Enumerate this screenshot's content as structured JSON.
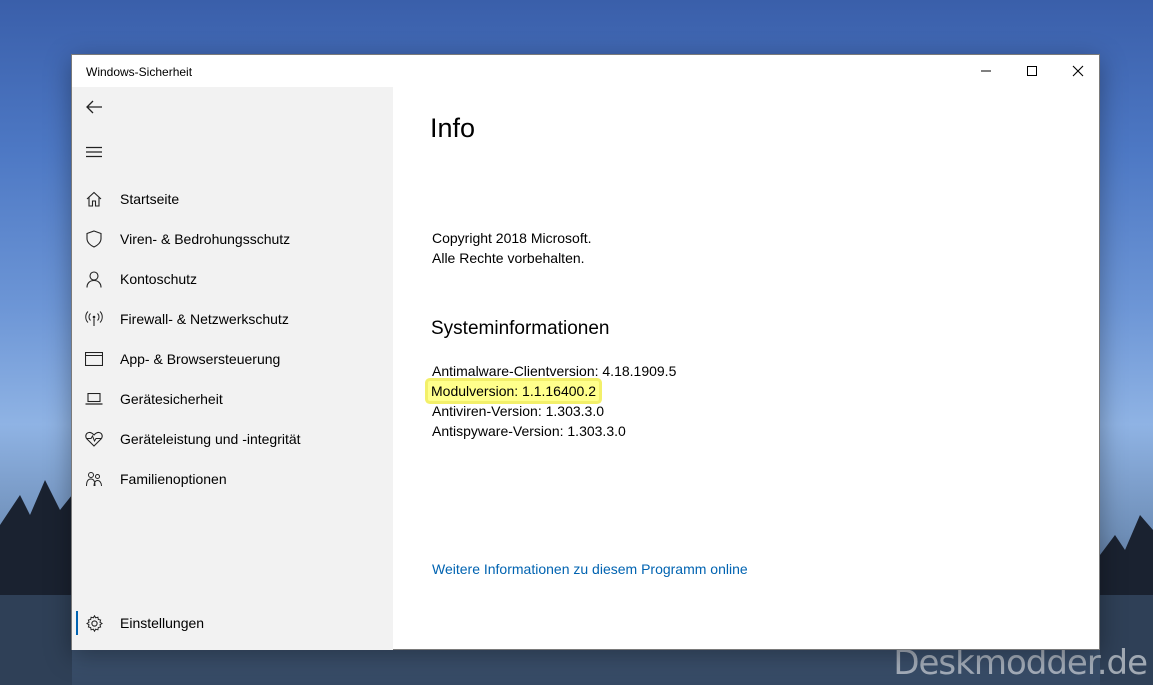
{
  "window": {
    "title": "Windows-Sicherheit",
    "controls": {
      "minimize_icon": "minimize-icon",
      "maximize_icon": "maximize-icon",
      "close_icon": "close-icon"
    }
  },
  "sidebar": {
    "back_icon": "back-arrow-icon",
    "menu_icon": "hamburger-menu-icon",
    "items": [
      {
        "label": "Startseite",
        "icon": "home-icon"
      },
      {
        "label": "Viren- & Bedrohungsschutz",
        "icon": "shield-icon"
      },
      {
        "label": "Kontoschutz",
        "icon": "person-icon"
      },
      {
        "label": "Firewall- & Netzwerkschutz",
        "icon": "antenna-icon"
      },
      {
        "label": "App- & Browsersteuerung",
        "icon": "browser-window-icon"
      },
      {
        "label": "Gerätesicherheit",
        "icon": "laptop-icon"
      },
      {
        "label": "Geräteleistung und -integrität",
        "icon": "heart-pulse-icon"
      },
      {
        "label": "Familienoptionen",
        "icon": "family-icon"
      }
    ],
    "settings": {
      "label": "Einstellungen",
      "icon": "gear-icon"
    }
  },
  "main": {
    "title": "Info",
    "copyright_line1": "Copyright 2018 Microsoft.",
    "copyright_line2": "Alle Rechte vorbehalten.",
    "sysinfo_heading": "Systeminformationen",
    "sysinfo": [
      "Antimalware-Clientversion: 4.18.1909.5",
      "Modulversion: 1.1.16400.2",
      "Antiviren-Version: 1.303.3.0",
      "Antispyware-Version: 1.303.3.0"
    ],
    "highlight_color": "#ffff8c",
    "more_link": "Weitere Informationen zu diesem Programm online",
    "link_color": "#0063b1"
  },
  "watermark": "Deskmodder.de"
}
